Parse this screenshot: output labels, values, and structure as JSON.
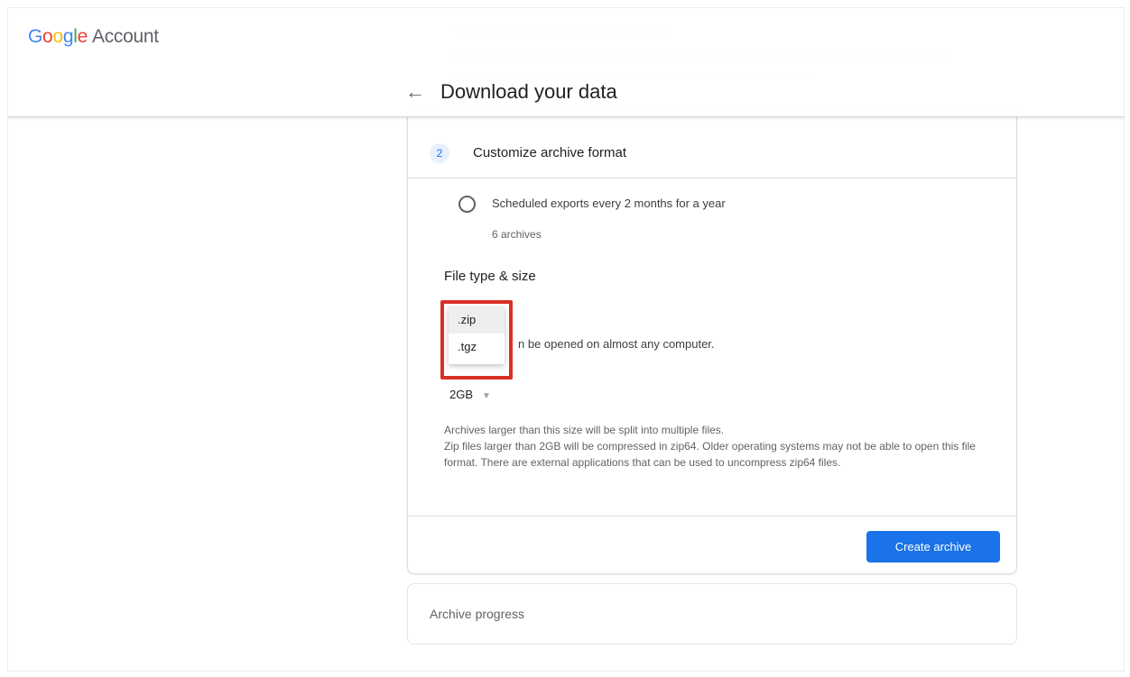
{
  "header": {
    "logo": {
      "G1": "G",
      "o1": "o",
      "o2": "o",
      "g": "g",
      "l": "l",
      "e": "e"
    },
    "logo_suffix": "Account",
    "back_icon": "arrow-left-icon",
    "title": "Download your data"
  },
  "step": {
    "number": "2",
    "title": "Customize archive format"
  },
  "frequency": {
    "option_label": "Scheduled exports every 2 months for a year",
    "option_sub": "6 archives"
  },
  "file_type": {
    "section_title": "File type & size",
    "options": [
      ".zip",
      ".tgz"
    ],
    "selected": ".zip",
    "description_partial": "n be opened on almost any computer."
  },
  "file_size": {
    "value": "2GB"
  },
  "notes": {
    "line1": "Archives larger than this size will be split into multiple files.",
    "line2": "Zip files larger than 2GB will be compressed in zip64. Older operating systems may not be able to open this file format. There are external applications that can be used to uncompress zip64 files."
  },
  "actions": {
    "create_label": "Create archive"
  },
  "progress": {
    "label": "Archive progress"
  },
  "colors": {
    "accent": "#1a73e8",
    "highlight": "#d93025"
  }
}
